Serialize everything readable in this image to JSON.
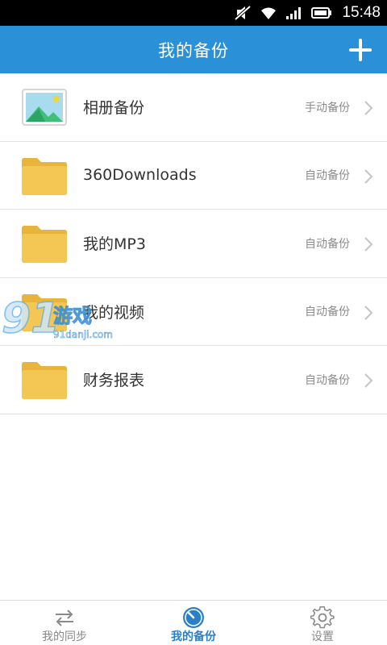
{
  "status_bar": {
    "time": "15:48",
    "icons": [
      "mute-icon",
      "wifi-icon",
      "signal-icon",
      "battery-icon"
    ]
  },
  "header": {
    "title": "我的备份",
    "add_icon": "plus-icon"
  },
  "backup_list": [
    {
      "icon": "album-icon",
      "label": "相册备份",
      "status": "手动备份"
    },
    {
      "icon": "folder-icon",
      "label": "360Downloads",
      "status": "自动备份"
    },
    {
      "icon": "folder-icon",
      "label": "我的MP3",
      "status": "自动备份"
    },
    {
      "icon": "folder-icon",
      "label": "我的视频",
      "status": "自动备份"
    },
    {
      "icon": "folder-icon",
      "label": "财务报表",
      "status": "自动备份"
    }
  ],
  "watermark": {
    "brand": "游戏",
    "site": "91danji.com"
  },
  "bottom_nav": [
    {
      "icon": "sync-icon",
      "label": "我的同步",
      "active": false
    },
    {
      "icon": "backup-clock-icon",
      "label": "我的备份",
      "active": true
    },
    {
      "icon": "gear-icon",
      "label": "设置",
      "active": false
    }
  ],
  "colors": {
    "status_bar": "#000000",
    "header": "#2a90d8",
    "folder": "#f2c14e",
    "active_nav": "#2a7fc8",
    "inactive_nav": "#888888"
  }
}
